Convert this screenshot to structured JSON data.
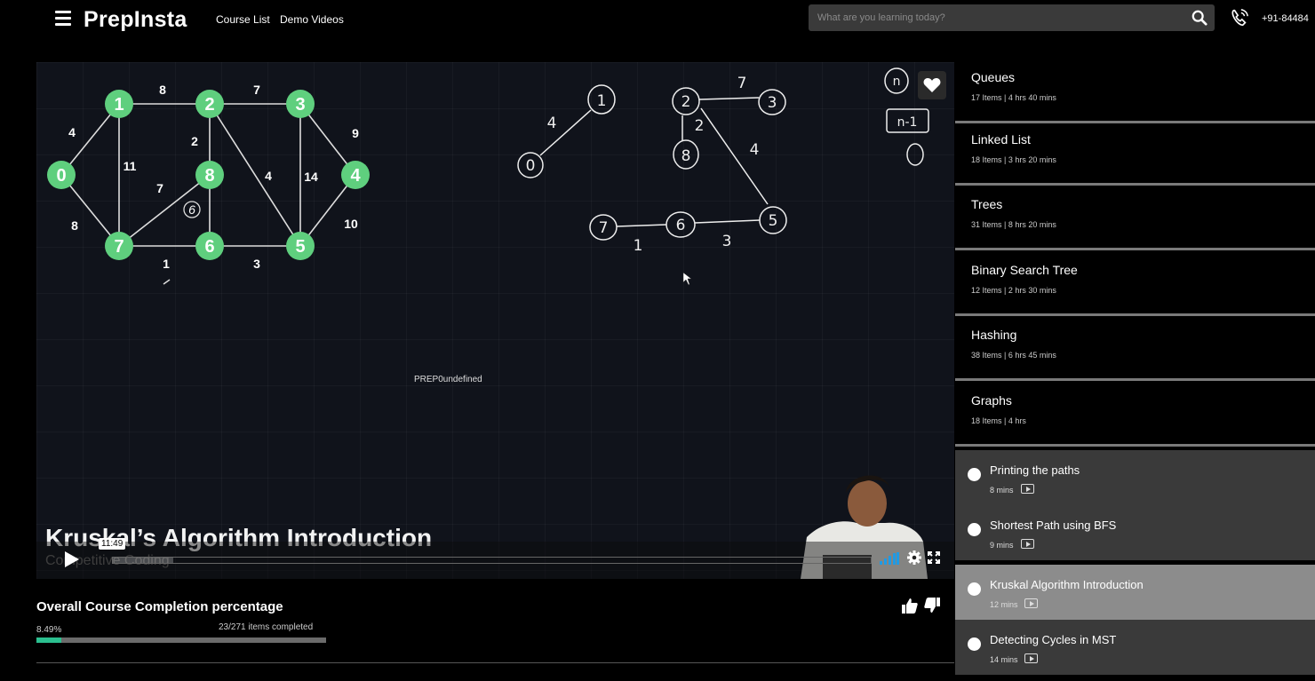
{
  "header": {
    "logo": "PrepInsta",
    "nav": [
      "Course List",
      "Demo Videos"
    ],
    "search_placeholder": "What are you learning today?",
    "phone": "+91-84484"
  },
  "video": {
    "title": "Kruskal’s Algorithm Introduction",
    "subtitle": "Competitive Coding",
    "watermark": "PREP0undefined",
    "current_time": "11:49",
    "progress": 0.08,
    "graph": {
      "nodes": [
        "0",
        "1",
        "2",
        "3",
        "4",
        "5",
        "6",
        "7",
        "8"
      ],
      "edge_weights": [
        "4",
        "8",
        "7",
        "9",
        "10",
        "14",
        "4",
        "2",
        "11",
        "7",
        "6",
        "8",
        "1",
        "3"
      ]
    },
    "sketch_labels": [
      "1",
      "4",
      "0",
      "2",
      "7",
      "3",
      "2",
      "8",
      "4",
      "7",
      "6",
      "5",
      "1",
      "3",
      "n",
      "n-1"
    ]
  },
  "completion": {
    "title": "Overall Course Completion percentage",
    "percent_label": "8.49%",
    "percent": 8.49,
    "items_label": "23/271 items completed"
  },
  "sidebar": {
    "modules": [
      {
        "name": "Queues",
        "meta": "17 Items | 4 hrs 40 mins"
      },
      {
        "name": "Linked List",
        "meta": "18 Items | 3 hrs 20 mins"
      },
      {
        "name": "Trees",
        "meta": "31 Items | 8 hrs 20 mins"
      },
      {
        "name": "Binary Search Tree",
        "meta": "12 Items | 2 hrs 30 mins"
      },
      {
        "name": "Hashing",
        "meta": "38 Items | 6 hrs 45 mins"
      },
      {
        "name": "Graphs",
        "meta": "18 Items | 4 hrs"
      }
    ],
    "lessons": [
      {
        "name": "Printing the paths",
        "duration": "8 mins",
        "active": false
      },
      {
        "name": "Shortest Path using BFS",
        "duration": "9 mins",
        "active": false
      },
      {
        "name": "Kruskal Algorithm Introduction",
        "duration": "12 mins",
        "active": true
      },
      {
        "name": "Detecting Cycles in MST",
        "duration": "14 mins",
        "active": false
      }
    ]
  }
}
